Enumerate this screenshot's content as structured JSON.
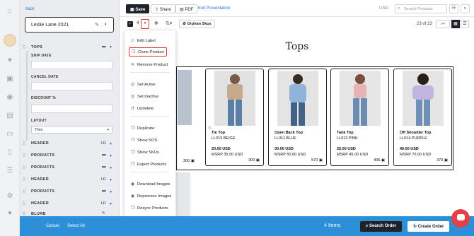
{
  "sidebar": {
    "back": "back",
    "linesheet_name": "Leslie Lane 2021",
    "tops_section": "TOPS",
    "fields": [
      {
        "label": "SHIP DATE",
        "value": ""
      },
      {
        "label": "CANCEL DATE",
        "value": ""
      },
      {
        "label": "DISCOUNT %",
        "value": ""
      }
    ],
    "layout_label": "LAYOUT",
    "layout_value": "Tiles",
    "sections": [
      {
        "label": "HEADER",
        "ctrl": "H1"
      },
      {
        "label": "PRODUCTS",
        "ctrl": ""
      },
      {
        "label": "PRODUCTS",
        "ctrl": ""
      },
      {
        "label": "HEADER",
        "ctrl": "H1"
      },
      {
        "label": "PRODUCTS",
        "ctrl": ""
      },
      {
        "label": "HEADER",
        "ctrl": "H1"
      },
      {
        "label": "BLURB",
        "ctrl": ""
      }
    ]
  },
  "toolbar": {
    "save": "Save",
    "share": "Share",
    "pdf": "PDF",
    "exit": "Exit Presentation",
    "currency": "USD",
    "search_placeholder": "Search Products"
  },
  "toolbar2": {
    "selected_count": "4",
    "orphan": "Orphan Skus",
    "pager": "23 of 23"
  },
  "menu": {
    "items": [
      {
        "label": "Edit Label",
        "icon": "tag-icon"
      },
      {
        "label": "Clone Product",
        "icon": "copy-icon"
      },
      {
        "label": "Remove Product",
        "icon": "close-icon"
      },
      {
        "label": "Set Active",
        "icon": "check-circle-icon"
      },
      {
        "label": "Set Inactive",
        "icon": "check-circle-icon"
      },
      {
        "label": "Undelete",
        "icon": "undo-icon"
      },
      {
        "label": "Duplicate",
        "icon": "copy-icon"
      },
      {
        "label": "Show SOS",
        "icon": "copy-icon"
      },
      {
        "label": "Show SKUs",
        "icon": "copy-icon"
      },
      {
        "label": "Export Products",
        "icon": "copy-icon"
      },
      {
        "label": "Download Images",
        "icon": "image-icon"
      },
      {
        "label": "Reprocess Images",
        "icon": "image-icon"
      },
      {
        "label": "Resync Products",
        "icon": "copy-icon"
      }
    ]
  },
  "page_title": "Tops",
  "partial_card": {
    "qty": "300"
  },
  "products": [
    {
      "name": "Tie Top",
      "code": "LL015 BEIGE",
      "price": "20.00 USD",
      "msrp": "MSRP 35.00 USD",
      "qty": "300",
      "color": "#c7a98c"
    },
    {
      "name": "Open Back Top",
      "code": "LL011 BLUE",
      "price": "30.00 USD",
      "msrp": "MSRP 50.00 USD",
      "qty": "570",
      "color": "#8fb3d9"
    },
    {
      "name": "Tank Top",
      "code": "LL013 PINK",
      "price": "25.00 USD",
      "msrp": "MSRP 45.00 USD",
      "qty": "405",
      "color": "#e7b3b5"
    },
    {
      "name": "Off Shoulder Top",
      "code": "LL014 PURPLE",
      "price": "40.00 USD",
      "msrp": "MSRP 70.00 USD",
      "qty": "370",
      "color": "#c3b4dd"
    }
  ],
  "bottom": {
    "cancel": "Cancel",
    "select_all": "Select All",
    "items": "4 Items",
    "search_order": "Search Order",
    "create_order": "Create Order"
  },
  "colors": {
    "accent": "#2d8fd8",
    "highlight": "#e0342b",
    "dark": "#1f2329"
  }
}
